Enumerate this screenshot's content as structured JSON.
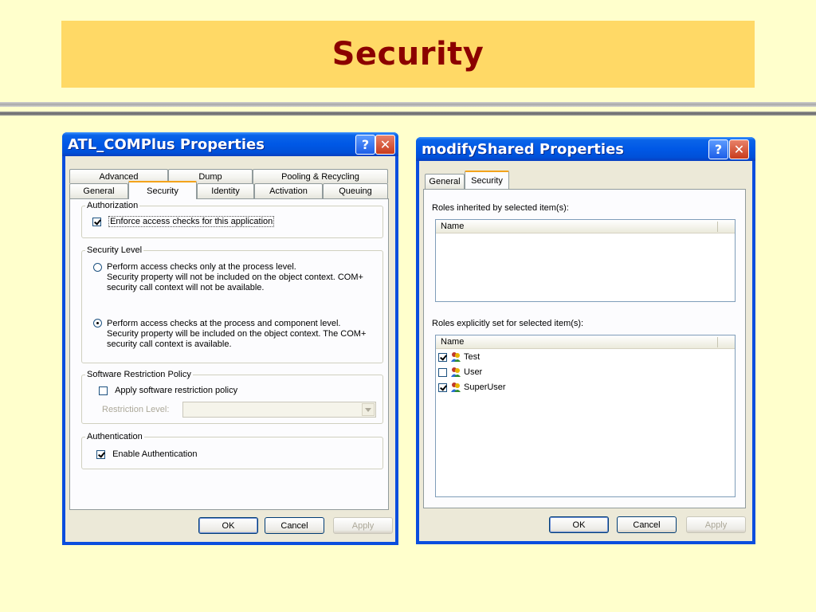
{
  "slide": {
    "title": "Security"
  },
  "dialog1": {
    "title": "ATL_COMPlus Properties",
    "help_glyph": "?",
    "close_glyph": "✕",
    "tabs_row1": [
      "Advanced",
      "Dump",
      "Pooling & Recycling"
    ],
    "tabs_row2": [
      "General",
      "Security",
      "Identity",
      "Activation",
      "Queuing"
    ],
    "active_tab": "Security",
    "authorization": {
      "legend": "Authorization",
      "enforce_label": "Enforce access checks for this application",
      "enforce_checked": true
    },
    "security_level": {
      "legend": "Security Level",
      "option1_line1": "Perform access checks only at the process level.",
      "option1_line2": "Security property will not be included on the object context.  COM+",
      "option1_line3": "security call context will not be available.",
      "option1_selected": false,
      "option2_line1": "Perform access checks at the process and component level.",
      "option2_line2": "Security property will be included on the object context. The COM+",
      "option2_line3": "security call context is available.",
      "option2_selected": true
    },
    "srp": {
      "legend": "Software Restriction Policy",
      "apply_label": "Apply software restriction policy",
      "apply_checked": false,
      "level_label": "Restriction Level:",
      "level_value": ""
    },
    "authentication": {
      "legend": "Authentication",
      "enable_label": "Enable Authentication",
      "enable_checked": true
    },
    "buttons": {
      "ok": "OK",
      "cancel": "Cancel",
      "apply": "Apply"
    }
  },
  "dialog2": {
    "title": "modifyShared Properties",
    "help_glyph": "?",
    "close_glyph": "✕",
    "tabs": [
      "General",
      "Security"
    ],
    "active_tab": "Security",
    "inherited_label": "Roles inherited by selected item(s):",
    "inherited_column": "Name",
    "inherited_rows": [],
    "explicit_label": "Roles explicitly set for selected item(s):",
    "explicit_column": "Name",
    "roles": [
      {
        "name": "Test",
        "checked": true
      },
      {
        "name": "User",
        "checked": false
      },
      {
        "name": "SuperUser",
        "checked": true
      }
    ],
    "buttons": {
      "ok": "OK",
      "cancel": "Cancel",
      "apply": "Apply"
    }
  },
  "colors": {
    "background": "#ffffcc",
    "title_band": "#ffd966",
    "title_text": "#8b0000",
    "xp_titlebar": "#0058e6",
    "dialog_face": "#ece9d8",
    "active_tab_accent": "#f3a31b"
  }
}
